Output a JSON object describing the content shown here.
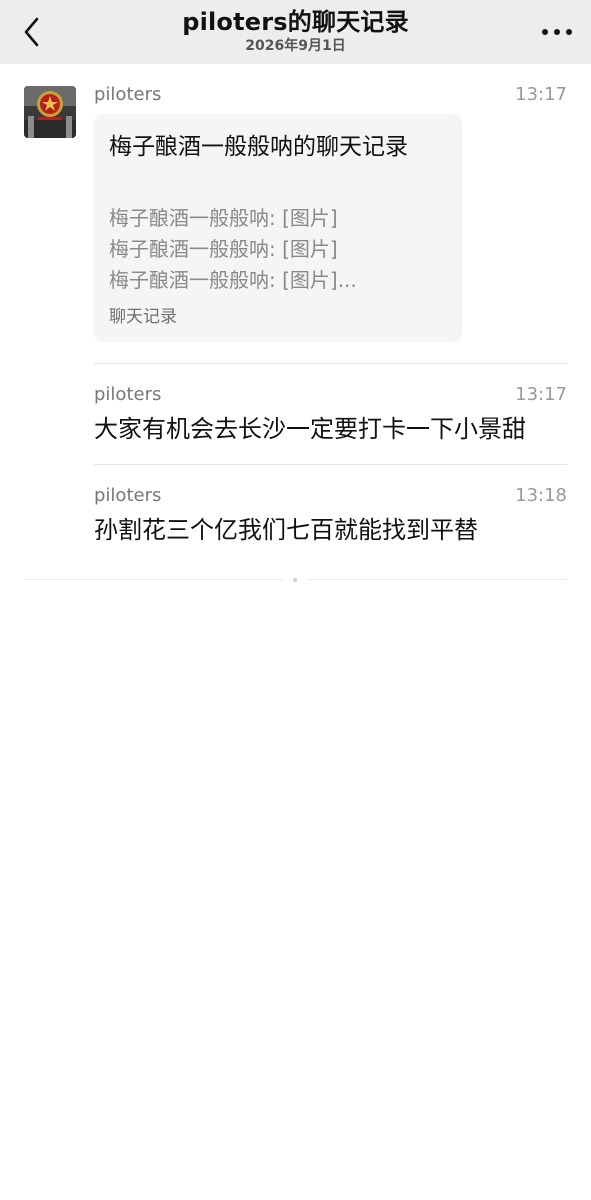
{
  "nav": {
    "title": "piloters的聊天记录",
    "subtitle": "2026年9月1日",
    "back_icon": "chevron-left-icon",
    "more_icon": "more-dots-icon"
  },
  "messages": [
    {
      "sender": "piloters",
      "time": "13:17",
      "card": {
        "title": "梅子酿酒一般般呐的聊天记录",
        "lines": [
          "梅子酿酒一般般呐: [图片]",
          "梅子酿酒一般般呐: [图片]",
          "梅子酿酒一般般呐: [图片]..."
        ],
        "footer": "聊天记录"
      }
    },
    {
      "sender": "piloters",
      "time": "13:17",
      "text": "大家有机会去长沙一定要打卡一下小景甜"
    },
    {
      "sender": "piloters",
      "time": "13:18",
      "text": "孙割花三个亿我们七百就能找到平替"
    }
  ],
  "colors": {
    "nav_background": "#ededed",
    "card_background": "#f5f5f5",
    "muted_text": "#8a8a8a"
  }
}
